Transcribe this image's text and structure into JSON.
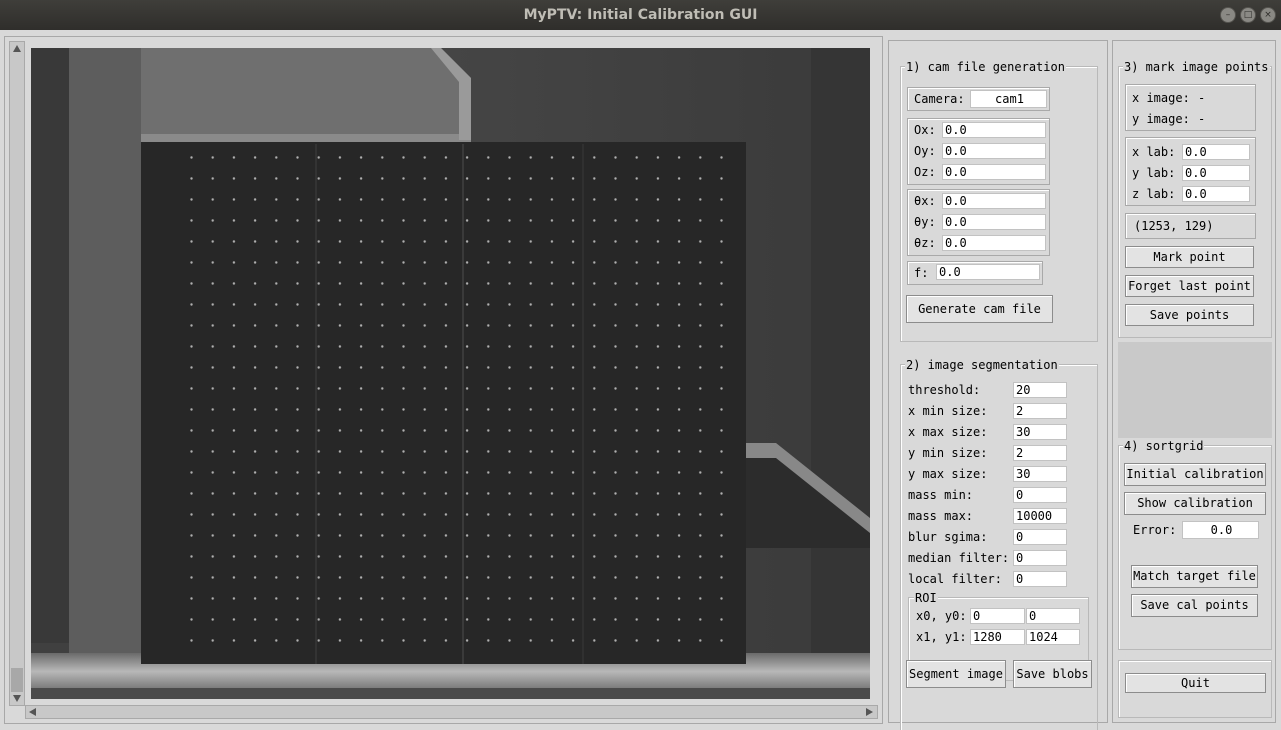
{
  "window": {
    "title": "MyPTV: Initial Calibration GUI"
  },
  "cam_file": {
    "legend": "1) cam file generation",
    "camera_label": "Camera:",
    "camera_value": "cam1",
    "o_rows": [
      {
        "label": "Ox:",
        "value": "0.0"
      },
      {
        "label": "Oy:",
        "value": "0.0"
      },
      {
        "label": "Oz:",
        "value": "0.0"
      }
    ],
    "theta_rows": [
      {
        "label": "θx:",
        "value": "0.0"
      },
      {
        "label": "θy:",
        "value": "0.0"
      },
      {
        "label": "θz:",
        "value": "0.0"
      }
    ],
    "f_label": "f:",
    "f_value": "0.0",
    "generate_button": "Generate cam file"
  },
  "segmentation": {
    "legend": "2) image segmentation",
    "rows": [
      {
        "label": "threshold:",
        "value": "20"
      },
      {
        "label": "x min size:",
        "value": "2"
      },
      {
        "label": "x max size:",
        "value": "30"
      },
      {
        "label": "y min size:",
        "value": "2"
      },
      {
        "label": "y max size:",
        "value": "30"
      },
      {
        "label": "mass min:",
        "value": "0"
      },
      {
        "label": "mass max:",
        "value": "10000"
      },
      {
        "label": "blur sgima:",
        "value": "0"
      },
      {
        "label": "median filter:",
        "value": "0"
      },
      {
        "label": "local filter:",
        "value": "0"
      }
    ],
    "roi": {
      "legend": "ROI",
      "row1_label": "x0, y0:",
      "x0": "0",
      "y0": "0",
      "row2_label": "x1, y1:",
      "x1": "1280",
      "y1": "1024"
    },
    "segment_button": "Segment image",
    "save_blobs_button": "Save blobs"
  },
  "mark": {
    "legend": "3) mark image points",
    "x_image_label": "x image:",
    "x_image_value": "-",
    "y_image_label": "y image:",
    "y_image_value": "-",
    "lab_rows": [
      {
        "label": "x lab:",
        "value": "0.0"
      },
      {
        "label": "y lab:",
        "value": "0.0"
      },
      {
        "label": "z lab:",
        "value": "0.0"
      }
    ],
    "cursor_readout": "(1253, 129)",
    "mark_button": "Mark point",
    "forget_button": "Forget last point",
    "save_points_button": "Save points"
  },
  "sortgrid": {
    "legend": "4) sortgrid",
    "initial_button": "Initial calibration",
    "show_button": "Show calibration",
    "error_label": "Error:",
    "error_value": "0.0",
    "match_button": "Match target file",
    "save_cal_button": "Save cal points"
  },
  "quit_button": "Quit"
}
